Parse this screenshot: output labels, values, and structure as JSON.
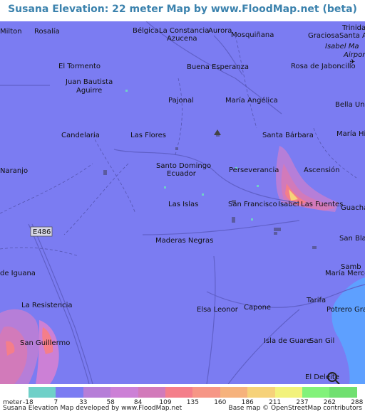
{
  "title": "Susana Elevation: 22 meter Map by www.FloodMap.net (beta)",
  "colors": {
    "base": "#7b7cf2",
    "low": "#6b6ff0",
    "water": "#5ea0ff",
    "title": "#3b82ad"
  },
  "places": [
    "Milton",
    "Rosalía",
    "Bélgica",
    "La Constancia",
    "Aurora",
    "Azucena",
    "Mosquiñana",
    "Trinidad",
    "Graciosa",
    "Santa A",
    "Isabel Ma",
    "Airport",
    "El Tormento",
    "Buena Esperanza",
    "Rosa de Jaboncillo",
    "Juan Bautista",
    "Aguirre",
    "Pajonal",
    "María Angélica",
    "Bella Uni",
    "Candelaria",
    "Las Flores",
    "Santa Bárbara",
    "María Hil",
    "Santo Domingo",
    "Ecuador",
    "Naranjo",
    "Perseverancia",
    "Ascensión",
    "Las Islas",
    "San Francisco",
    "Isabel",
    "Las Fuentes",
    "Guacha",
    "E486",
    "Maderas Negras",
    "San Bla",
    "Samb",
    "de Iguana",
    "María Merce",
    "Tarifa",
    "La Resistencia",
    "Elsa Leonor",
    "Capone",
    "Potrero Gra",
    "San Guillermo",
    "Isla de Guare",
    "San Gil",
    "El Deleite"
  ],
  "legend": {
    "unit_label": "meter",
    "ticks": [
      "-18",
      "7",
      "33",
      "58",
      "84",
      "109",
      "135",
      "160",
      "186",
      "211",
      "237",
      "262",
      "288"
    ],
    "swatches": [
      "#6fd0c8",
      "#7b7cf2",
      "#b67ed8",
      "#cc80d6",
      "#d27aba",
      "#f47e8a",
      "#f69686",
      "#f6b27c",
      "#f6d27a",
      "#f2f27c",
      "#82f27a",
      "#70e070"
    ]
  },
  "credits": {
    "left": "Susana Elevation Map developed by www.FloodMap.net",
    "right": "Base map © OpenStreetMap contributors"
  }
}
